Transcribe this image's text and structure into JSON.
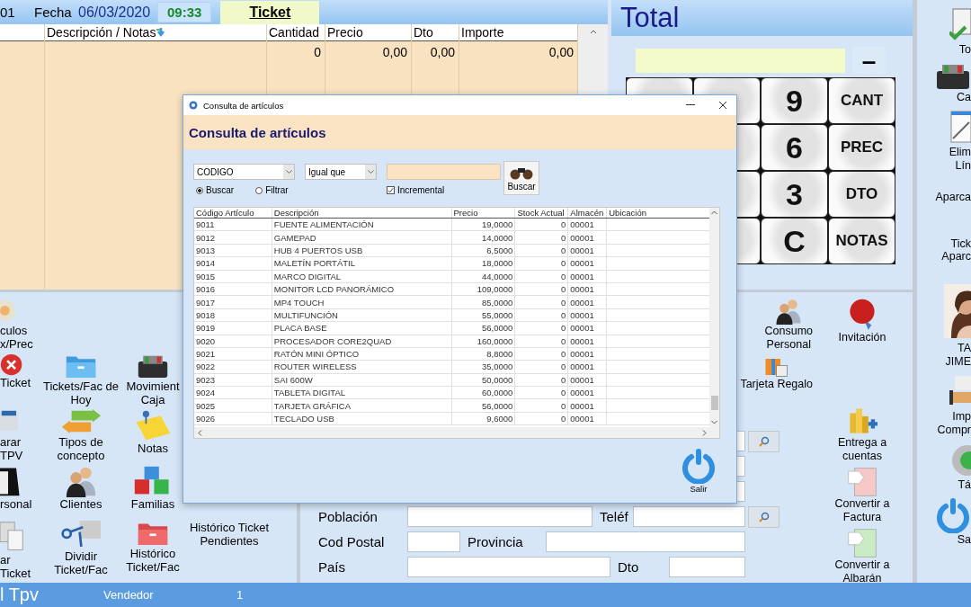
{
  "ticket_header": {
    "number": "01",
    "date_label": "Fecha",
    "date": "06/03/2020",
    "time": "09:33",
    "mode": "Ticket"
  },
  "ticket_table": {
    "columns": [
      "Descripción / Notas",
      "Cantidad",
      "Precio",
      "Dto",
      "Importe"
    ],
    "rows": [
      {
        "values": [
          "0",
          "0,00",
          "0,00",
          "0,00"
        ]
      }
    ]
  },
  "total_panel": {
    "title": "Total",
    "sign_button": "–"
  },
  "keypad": [
    {
      "label": "9",
      "kind": "digit"
    },
    {
      "label": "CANT",
      "kind": "function"
    },
    {
      "label": "6",
      "kind": "digit"
    },
    {
      "label": "PREC",
      "kind": "function"
    },
    {
      "label": "3",
      "kind": "digit"
    },
    {
      "label": "DTO",
      "kind": "function"
    },
    {
      "label": "C",
      "kind": "digit"
    },
    {
      "label": "NOTAS",
      "kind": "function"
    }
  ],
  "tool_rows": [
    [
      {
        "label": "culos\nx/Prec"
      }
    ],
    [
      {
        "label": "Ticket"
      },
      {
        "label": "Tickets/Fac de\nHoy"
      },
      {
        "label": "Movimient\nCaja"
      }
    ],
    [
      {
        "label": "arar TPV"
      },
      {
        "label": "Tipos de\nconcepto"
      },
      {
        "label": "Notas"
      }
    ],
    [
      {
        "label": "rsonal"
      },
      {
        "label": "Clientes"
      },
      {
        "label": "Familias"
      }
    ],
    [
      {
        "label": "ar Ticket"
      },
      {
        "label": "Dividir\nTicket/Fac"
      },
      {
        "label": "Histórico\nTicket/Fac"
      },
      {
        "label": "Histórico Ticket\nPendientes"
      }
    ]
  ],
  "personal_actions": [
    {
      "label": "Consumo\nPersonal"
    },
    {
      "label": "Tarjeta Regalo"
    }
  ],
  "document_actions": [
    {
      "label": "Invitación"
    },
    {
      "label": "Entrega a\ncuentas"
    },
    {
      "label": "Convertir a\nFactura"
    },
    {
      "label": "Convertir a\nAlbarán"
    }
  ],
  "client_form": {
    "rows": [
      {
        "kind": "covered",
        "search": true
      },
      {
        "kind": "covered",
        "search": false
      },
      {
        "kind": "covered",
        "search": false
      },
      {
        "kind": "pair",
        "label": "Población",
        "label2": "Teléf",
        "search": true
      },
      {
        "kind": "pair",
        "label": "Cod Postal",
        "label2": "Provincia",
        "search": false
      },
      {
        "kind": "pair",
        "label": "País",
        "label2": "Dto",
        "search": false
      }
    ]
  },
  "side_tools": [
    {
      "kind": "icon",
      "label": "To"
    },
    {
      "kind": "icon",
      "label": "Ca"
    },
    {
      "kind": "icon",
      "label": "Elim\nLín"
    },
    {
      "kind": "text",
      "label": "Aparca"
    },
    {
      "kind": "text",
      "label": "Tick\nAparc"
    },
    {
      "kind": "user",
      "label": "TA\nJIME"
    },
    {
      "kind": "icon",
      "label": "Imp\nCompr"
    },
    {
      "kind": "icon",
      "label": "Tá"
    },
    {
      "kind": "icon",
      "label": "Sa"
    }
  ],
  "status_bar": {
    "app": "l Tpv",
    "seller_label": "Vendedor",
    "seller": "1"
  },
  "dialog": {
    "window_title": "Consulta de artículos",
    "heading": "Consulta de artículos",
    "field_select": "CODIGO",
    "operator_select": "Igual que",
    "search_button": "Buscar",
    "modes": [
      {
        "label": "Buscar",
        "selected": true
      },
      {
        "label": "Filtrar",
        "selected": false
      }
    ],
    "incremental": {
      "label": "Incremental",
      "checked": true
    },
    "columns": [
      "Código Artículo",
      "Descripción",
      "Precio",
      "Stock Actual",
      "Almacén",
      "Ubicación"
    ],
    "rows": [
      [
        "9011",
        "FUENTE ALIMENTACIÓN",
        "19,0000",
        "0",
        "00001"
      ],
      [
        "9012",
        "GAMEPAD",
        "14,0000",
        "0",
        "00001"
      ],
      [
        "9013",
        "HUB 4 PUERTOS USB",
        "6,5000",
        "0",
        "00001"
      ],
      [
        "9014",
        "MALETÍN PORTÁTIL",
        "18,0000",
        "0",
        "00001"
      ],
      [
        "9015",
        "MARCO DIGITAL",
        "44,0000",
        "0",
        "00001"
      ],
      [
        "9016",
        "MONITOR LCD PANORÁMICO",
        "109,0000",
        "0",
        "00001"
      ],
      [
        "9017",
        "MP4 TOUCH",
        "85,0000",
        "0",
        "00001"
      ],
      [
        "9018",
        "MULTIFUNCIÓN",
        "55,0000",
        "0",
        "00001"
      ],
      [
        "9019",
        "PLACA BASE",
        "56,0000",
        "0",
        "00001"
      ],
      [
        "9020",
        "PROCESADOR CORE2QUAD",
        "160,0000",
        "0",
        "00001"
      ],
      [
        "9021",
        "RATÓN MINI ÓPTICO",
        "8,8000",
        "0",
        "00001"
      ],
      [
        "9022",
        "ROUTER WIRELESS",
        "35,0000",
        "0",
        "00001"
      ],
      [
        "9023",
        "SAI 600W",
        "50,0000",
        "0",
        "00001"
      ],
      [
        "9024",
        "TABLETA DIGITAL",
        "60,0000",
        "0",
        "00001"
      ],
      [
        "9025",
        "TARJETA GRÁFICA",
        "56,0000",
        "0",
        "00001"
      ],
      [
        "9026",
        "TECLADO USB",
        "9,6000",
        "0",
        "00001"
      ]
    ],
    "exit_button": "Salir"
  }
}
